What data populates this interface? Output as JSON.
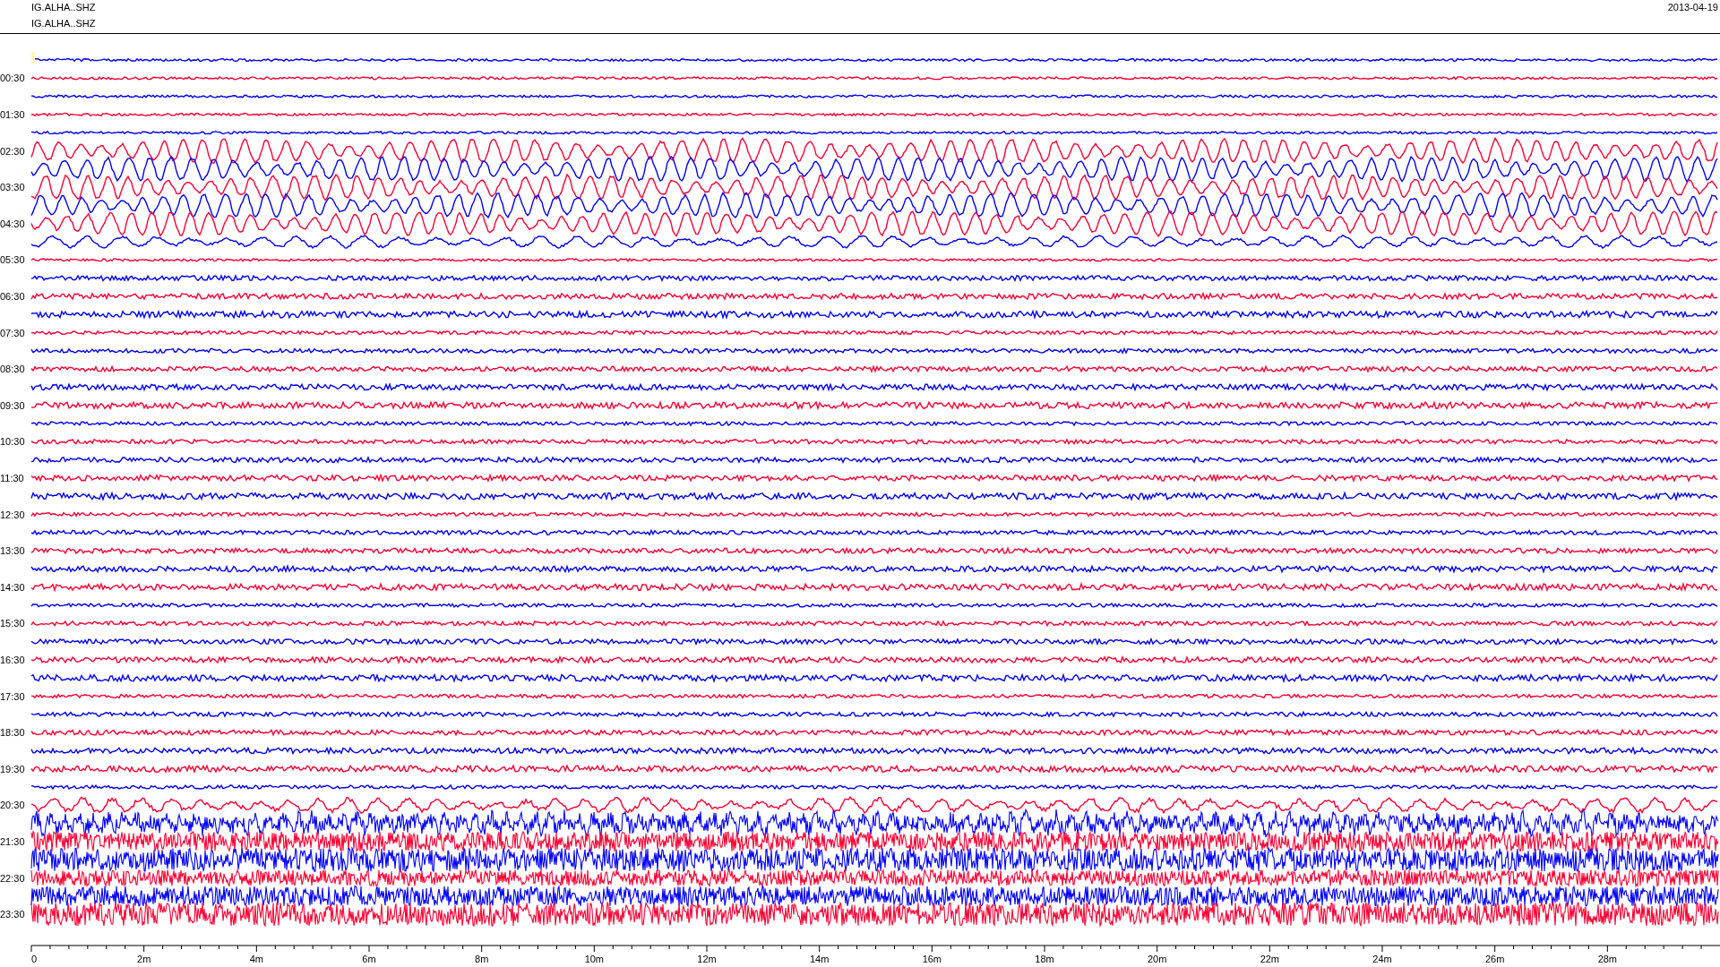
{
  "header": {
    "titles": [
      "IG.ALHA..SHZ",
      "IG.ALHA..SHZ"
    ],
    "date": "2013-04-19"
  },
  "hour_labels": [
    "00:30",
    "01:30",
    "02:30",
    "03:30",
    "04:30",
    "05:30",
    "06:30",
    "07:30",
    "08:30",
    "09:30",
    "10:30",
    "11:30",
    "12:30",
    "13:30",
    "14:30",
    "15:30",
    "16:30",
    "17:30",
    "18:30",
    "19:30",
    "20:30",
    "21:30",
    "22:30",
    "23:30"
  ],
  "traces": [
    {
      "color": "#0000ff"
    },
    {
      "color": "#ff0033"
    },
    {
      "color": "#0000ff"
    },
    {
      "color": "#ff0033"
    },
    {
      "color": "#0000ff"
    },
    {
      "color": "#ff0033"
    },
    {
      "color": "#0000ff"
    },
    {
      "color": "#ff0033"
    },
    {
      "color": "#0000ff"
    },
    {
      "color": "#ff0033"
    },
    {
      "color": "#0000ff"
    },
    {
      "color": "#ff0033"
    },
    {
      "color": "#0000ff"
    },
    {
      "color": "#ff0033"
    },
    {
      "color": "#0000ff"
    },
    {
      "color": "#ff0033"
    },
    {
      "color": "#0000ff"
    },
    {
      "color": "#ff0033"
    },
    {
      "color": "#0000ff"
    },
    {
      "color": "#ff0033"
    },
    {
      "color": "#0000ff"
    },
    {
      "color": "#ff0033"
    },
    {
      "color": "#0000ff"
    },
    {
      "color": "#ff0033"
    },
    {
      "color": "#0000ff"
    },
    {
      "color": "#ff0033"
    },
    {
      "color": "#0000ff"
    },
    {
      "color": "#ff0033"
    },
    {
      "color": "#0000ff"
    },
    {
      "color": "#ff0033"
    },
    {
      "color": "#0000ff"
    },
    {
      "color": "#ff0033"
    },
    {
      "color": "#0000ff"
    },
    {
      "color": "#ff0033"
    },
    {
      "color": "#0000ff"
    },
    {
      "color": "#ff0033"
    },
    {
      "color": "#0000ff"
    },
    {
      "color": "#ff0033"
    },
    {
      "color": "#0000ff"
    },
    {
      "color": "#ff0033"
    },
    {
      "color": "#0000ff"
    },
    {
      "color": "#ff0033"
    },
    {
      "color": "#0000ff"
    },
    {
      "color": "#ff0033"
    },
    {
      "color": "#0000ff"
    },
    {
      "color": "#ff0033"
    },
    {
      "color": "#0000ff"
    },
    {
      "color": "#ff0033"
    }
  ],
  "x_axis": {
    "labels": [
      "0",
      "2m",
      "4m",
      "6m",
      "8m",
      "10m",
      "12m",
      "14m",
      "16m",
      "18m",
      "20m",
      "22m",
      "24m",
      "26m",
      "28m"
    ]
  }
}
